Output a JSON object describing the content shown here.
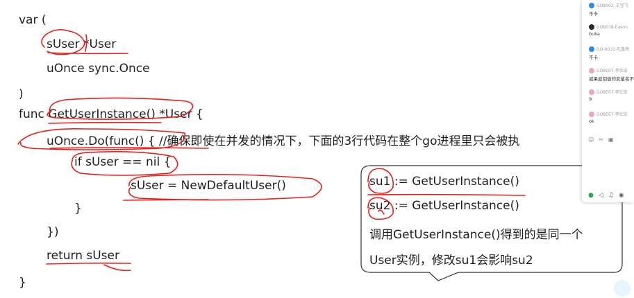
{
  "code": {
    "lines": [
      "var (",
      "sUser *User",
      "uOnce sync.Once",
      ")",
      "func GetUserInstance() *User {",
      "uOnce.Do(func() { //确保即使在并发的情况下，下面的3行代码在整个go进程里只会被执",
      "if sUser == nil {",
      "sUser = NewDefaultUser()",
      "}",
      "})",
      "return sUser",
      "}"
    ]
  },
  "callout": {
    "lines": [
      "su1 := GetUserInstance()",
      "su2 := GetUserInstance()",
      "调用GetUserInstance()得到的是同一个",
      "User实例，修改su1会影响su2"
    ]
  },
  "chat": {
    "messages": [
      {
        "sender": "GO8002_王豆飞",
        "text": "不卡",
        "avatar_color": "#2d8ce8"
      },
      {
        "sender": "GO8038-Eason",
        "text": "buka",
        "avatar_color": "#2b2b2b"
      },
      {
        "sender": "GO-8031-孔鑫亮",
        "text": "不卡",
        "avatar_color": "#2d8ce8"
      },
      {
        "sender": "GO8057-李仕宏",
        "text": "如果返回值的变量名不",
        "avatar_color": "#e8a9b6"
      },
      {
        "sender": "GO8057-李仕宏",
        "text": "9",
        "avatar_color": "#e8a9b6"
      },
      {
        "sender": "GO8057-李仕宏",
        "text": "ok",
        "avatar_color": "#e8a9b6"
      }
    ],
    "tool_icons": [
      "smiley-icon",
      "scissors-icon",
      "image-icon"
    ],
    "media_icons": [
      "microphone-icon",
      "speaker-icon",
      "music-icon",
      "camera-icon"
    ]
  },
  "colors": {
    "annotation": "#e8201a",
    "code_text": "#1f1f1f"
  }
}
